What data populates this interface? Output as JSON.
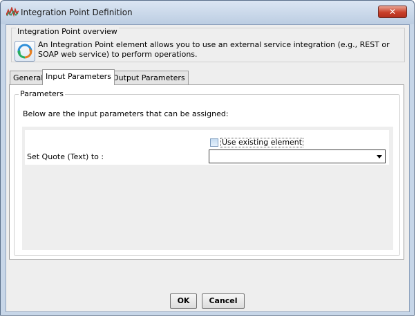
{
  "window": {
    "title": "Integration Point Definition",
    "close_label": "✕"
  },
  "overview": {
    "title": "Integration Point overview",
    "text": "An Integration Point element allows you to use an external service integration (e.g., REST or SOAP web service) to perform operations."
  },
  "tabs": [
    {
      "label": "General"
    },
    {
      "label": "Input Parameters",
      "active": true
    },
    {
      "label": "Output Parameters"
    }
  ],
  "parameters": {
    "title": "Parameters",
    "description": "Below are the input parameters that can be assigned:",
    "rows": [
      {
        "label": "Set Quote (Text) to :",
        "checkbox_label": "Use existing element",
        "checked": false,
        "value": ""
      }
    ]
  },
  "buttons": {
    "ok": "OK",
    "cancel": "Cancel"
  },
  "colors": {
    "title_bar": "#c7d6e8",
    "close_button": "#c9402a",
    "checkbox_fill": "#c6dcf1"
  }
}
